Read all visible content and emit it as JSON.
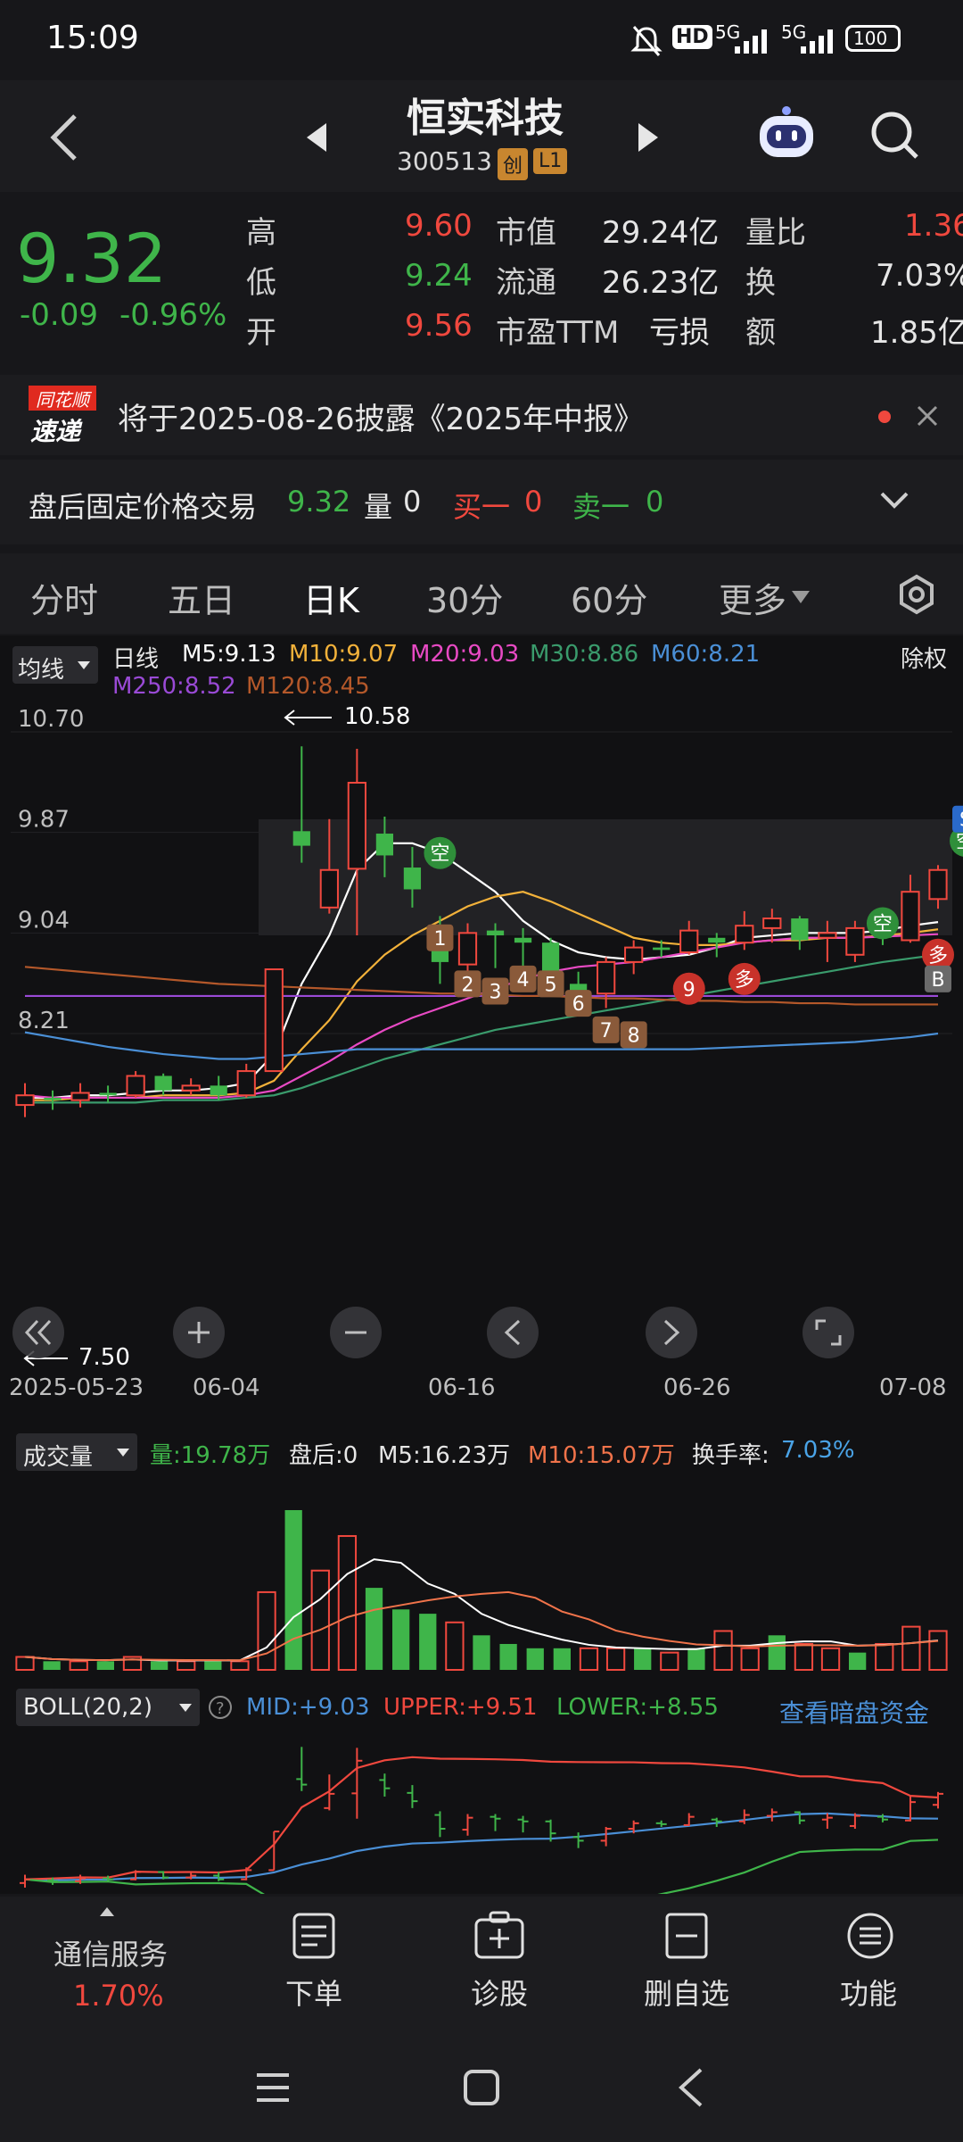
{
  "status": {
    "time": "15:09",
    "battery": "100",
    "net1": "5G",
    "net2": "5G"
  },
  "header": {
    "title": "恒实科技",
    "code": "300513",
    "badge1": "创",
    "badge2": "L1"
  },
  "quote": {
    "price": "9.32",
    "change": "-0.09",
    "pct": "-0.96%",
    "high_label": "高",
    "high": "9.60",
    "low_label": "低",
    "low": "9.24",
    "open_label": "开",
    "open": "9.56",
    "mcap_label": "市值",
    "mcap": "29.24亿",
    "float_label": "流通",
    "float": "26.23亿",
    "pe_label": "市盈TTM",
    "pe": "亏损",
    "vr_label": "量比",
    "vr": "1.36",
    "turn_label": "换",
    "turn": "7.03%",
    "amt_label": "额",
    "amt": "1.85亿"
  },
  "notice": {
    "logo_top": "同花顺",
    "logo_bottom": "速递",
    "text": "将于2025-08-26披露《2025年中报》"
  },
  "afterhours": {
    "label": "盘后固定价格交易",
    "price": "9.32",
    "vol_label": "量",
    "vol": "0",
    "buy_label": "买一",
    "buy": "0",
    "sell_label": "卖一",
    "sell": "0"
  },
  "tabs": [
    "分时",
    "五日",
    "日K",
    "30分",
    "60分",
    "更多"
  ],
  "ma_bar": {
    "selector": "均线",
    "period": "日线",
    "m5": "M5:9.13",
    "m10": "M10:9.07",
    "m20": "M20:9.03",
    "m30": "M30:8.86",
    "m60": "M60:8.21",
    "m250": "M250:8.52",
    "m120": "M120:8.45",
    "exright": "除权"
  },
  "chart_data": {
    "type": "candlestick",
    "y_ticks": [
      "10.70",
      "9.87",
      "9.04",
      "8.21"
    ],
    "x_ticks": [
      "2025-05-23",
      "06-04",
      "06-16",
      "06-26",
      "07-08"
    ],
    "max_label": "10.58",
    "min_label": "7.50",
    "candles": [
      {
        "o": 7.62,
        "c": 7.7,
        "h": 7.8,
        "l": 7.52
      },
      {
        "o": 7.68,
        "c": 7.66,
        "h": 7.74,
        "l": 7.58
      },
      {
        "o": 7.66,
        "c": 7.72,
        "h": 7.8,
        "l": 7.6
      },
      {
        "o": 7.72,
        "c": 7.7,
        "h": 7.78,
        "l": 7.64
      },
      {
        "o": 7.7,
        "c": 7.86,
        "h": 7.9,
        "l": 7.68
      },
      {
        "o": 7.86,
        "c": 7.74,
        "h": 7.88,
        "l": 7.7
      },
      {
        "o": 7.74,
        "c": 7.78,
        "h": 7.84,
        "l": 7.7
      },
      {
        "o": 7.78,
        "c": 7.7,
        "h": 7.86,
        "l": 7.66
      },
      {
        "o": 7.7,
        "c": 7.9,
        "h": 7.96,
        "l": 7.68
      },
      {
        "o": 7.9,
        "c": 8.74,
        "h": 8.74,
        "l": 7.9
      },
      {
        "o": 9.88,
        "c": 9.76,
        "h": 10.58,
        "l": 9.62
      },
      {
        "o": 9.25,
        "c": 9.56,
        "h": 9.98,
        "l": 9.2
      },
      {
        "o": 9.57,
        "c": 10.28,
        "h": 10.56,
        "l": 9.02
      },
      {
        "o": 9.86,
        "c": 9.68,
        "h": 10.0,
        "l": 9.5
      },
      {
        "o": 9.58,
        "c": 9.4,
        "h": 9.75,
        "l": 9.25
      },
      {
        "o": 9.1,
        "c": 8.8,
        "h": 9.18,
        "l": 8.62
      },
      {
        "o": 8.78,
        "c": 9.04,
        "h": 9.12,
        "l": 8.65
      },
      {
        "o": 9.06,
        "c": 9.02,
        "h": 9.12,
        "l": 8.75
      },
      {
        "o": 9.0,
        "c": 8.96,
        "h": 9.08,
        "l": 8.72
      },
      {
        "o": 8.96,
        "c": 8.7,
        "h": 9.0,
        "l": 8.52
      },
      {
        "o": 8.62,
        "c": 8.54,
        "h": 8.72,
        "l": 8.38
      },
      {
        "o": 8.54,
        "c": 8.8,
        "h": 8.84,
        "l": 8.42
      },
      {
        "o": 8.8,
        "c": 8.92,
        "h": 8.98,
        "l": 8.7
      },
      {
        "o": 8.92,
        "c": 8.9,
        "h": 8.98,
        "l": 8.84
      },
      {
        "o": 8.88,
        "c": 9.06,
        "h": 9.14,
        "l": 8.86
      },
      {
        "o": 9.0,
        "c": 8.96,
        "h": 9.04,
        "l": 8.84
      },
      {
        "o": 8.96,
        "c": 9.1,
        "h": 9.22,
        "l": 8.9
      },
      {
        "o": 9.08,
        "c": 9.16,
        "h": 9.24,
        "l": 8.96
      },
      {
        "o": 9.16,
        "c": 8.98,
        "h": 9.18,
        "l": 8.9
      },
      {
        "o": 9.0,
        "c": 9.04,
        "h": 9.14,
        "l": 8.8
      },
      {
        "o": 8.86,
        "c": 9.08,
        "h": 9.14,
        "l": 8.8
      },
      {
        "o": 9.06,
        "c": 9.0,
        "h": 9.12,
        "l": 8.94
      },
      {
        "o": 8.98,
        "c": 9.38,
        "h": 9.52,
        "l": 8.96
      },
      {
        "o": 9.32,
        "c": 9.56,
        "h": 9.6,
        "l": 9.24
      }
    ],
    "series": [
      {
        "name": "M5",
        "color": "#ffffff",
        "values": [
          7.68,
          7.68,
          7.7,
          7.7,
          7.72,
          7.74,
          7.74,
          7.76,
          7.8,
          8.04,
          8.62,
          9.02,
          9.56,
          9.78,
          9.78,
          9.7,
          9.54,
          9.38,
          9.14,
          8.98,
          8.88,
          8.84,
          8.82,
          8.84,
          8.86,
          8.92,
          9.0,
          9.02,
          9.04,
          9.04,
          9.04,
          9.06,
          9.1,
          9.13
        ]
      },
      {
        "name": "M10",
        "color": "#f2b13a",
        "values": [
          7.66,
          7.66,
          7.68,
          7.68,
          7.68,
          7.7,
          7.7,
          7.7,
          7.72,
          7.82,
          8.08,
          8.32,
          8.64,
          8.86,
          9.02,
          9.14,
          9.26,
          9.34,
          9.38,
          9.3,
          9.2,
          9.1,
          9.0,
          8.96,
          8.94,
          8.94,
          8.96,
          8.98,
          8.98,
          9.0,
          9.0,
          9.02,
          9.04,
          9.07
        ]
      },
      {
        "name": "M20",
        "color": "#e84ac4",
        "values": [
          7.7,
          7.68,
          7.68,
          7.68,
          7.68,
          7.68,
          7.68,
          7.68,
          7.7,
          7.74,
          7.86,
          7.98,
          8.12,
          8.24,
          8.34,
          8.42,
          8.5,
          8.58,
          8.66,
          8.72,
          8.76,
          8.78,
          8.8,
          8.84,
          8.88,
          8.92,
          8.96,
          8.98,
          9.0,
          9.0,
          9.0,
          9.01,
          9.02,
          9.03
        ]
      },
      {
        "name": "M30",
        "color": "#3a9b6c",
        "values": [
          7.64,
          7.64,
          7.64,
          7.64,
          7.64,
          7.66,
          7.66,
          7.66,
          7.68,
          7.7,
          7.76,
          7.84,
          7.92,
          8.0,
          8.06,
          8.12,
          8.18,
          8.24,
          8.28,
          8.32,
          8.36,
          8.4,
          8.44,
          8.48,
          8.52,
          8.56,
          8.6,
          8.64,
          8.68,
          8.72,
          8.76,
          8.8,
          8.83,
          8.86
        ]
      },
      {
        "name": "M60",
        "color": "#4a8fd6",
        "values": [
          8.22,
          8.18,
          8.14,
          8.1,
          8.07,
          8.04,
          8.02,
          8.0,
          8.0,
          8.02,
          8.04,
          8.06,
          8.08,
          8.08,
          8.08,
          8.08,
          8.08,
          8.08,
          8.08,
          8.08,
          8.08,
          8.08,
          8.08,
          8.08,
          8.08,
          8.09,
          8.1,
          8.11,
          8.12,
          8.13,
          8.14,
          8.16,
          8.18,
          8.21
        ]
      },
      {
        "name": "M250",
        "color": "#9a4ad6",
        "values": [
          8.52,
          8.52,
          8.52,
          8.52,
          8.52,
          8.52,
          8.52,
          8.52,
          8.52,
          8.52,
          8.52,
          8.52,
          8.52,
          8.52,
          8.52,
          8.52,
          8.52,
          8.52,
          8.52,
          8.52,
          8.52,
          8.52,
          8.52,
          8.52,
          8.52,
          8.52,
          8.52,
          8.52,
          8.52,
          8.52,
          8.52,
          8.52,
          8.52,
          8.52
        ]
      },
      {
        "name": "M120",
        "color": "#b4582a",
        "values": [
          8.76,
          8.74,
          8.72,
          8.7,
          8.68,
          8.66,
          8.64,
          8.62,
          8.61,
          8.6,
          8.59,
          8.58,
          8.57,
          8.56,
          8.55,
          8.54,
          8.54,
          8.53,
          8.52,
          8.52,
          8.51,
          8.5,
          8.5,
          8.49,
          8.48,
          8.48,
          8.47,
          8.47,
          8.46,
          8.46,
          8.45,
          8.45,
          8.45,
          8.45
        ]
      }
    ],
    "markers": [
      {
        "label": "空",
        "i": 15,
        "y": 9.7,
        "kind": "green"
      },
      {
        "label": "1",
        "i": 15,
        "y": 9.0,
        "kind": "num"
      },
      {
        "label": "2",
        "i": 16,
        "y": 8.62,
        "kind": "num"
      },
      {
        "label": "3",
        "i": 17,
        "y": 8.56,
        "kind": "num"
      },
      {
        "label": "4",
        "i": 18,
        "y": 8.66,
        "kind": "num"
      },
      {
        "label": "5",
        "i": 19,
        "y": 8.62,
        "kind": "num"
      },
      {
        "label": "6",
        "i": 20,
        "y": 8.46,
        "kind": "num"
      },
      {
        "label": "7",
        "i": 21,
        "y": 8.24,
        "kind": "num"
      },
      {
        "label": "8",
        "i": 22,
        "y": 8.2,
        "kind": "num"
      },
      {
        "label": "9",
        "i": 24,
        "y": 8.58,
        "kind": "red"
      },
      {
        "label": "多",
        "i": 26,
        "y": 8.66,
        "kind": "red"
      },
      {
        "label": "空",
        "i": 31,
        "y": 9.12,
        "kind": "green"
      },
      {
        "label": "多",
        "i": 33,
        "y": 8.86,
        "kind": "red"
      },
      {
        "label": "B",
        "i": 33,
        "y": 8.66,
        "kind": "grey"
      },
      {
        "label": "空",
        "i": 34,
        "y": 9.8,
        "kind": "green"
      },
      {
        "label": "S",
        "i": 34,
        "y": 9.98,
        "kind": "blue"
      }
    ]
  },
  "volume": {
    "selector": "成交量",
    "vol": "量:19.78万",
    "after": "盘后:0",
    "m5": "M5:16.23万",
    "m10": "M10:15.07万",
    "turnover_label": "换手率:",
    "turnover": "7.03%",
    "bars": [
      3,
      2,
      2,
      2,
      3,
      2,
      2,
      2,
      2,
      18,
      37,
      23,
      31,
      19,
      14,
      13,
      11,
      8,
      6,
      5,
      5,
      5,
      5,
      5,
      4,
      5,
      9,
      5,
      8,
      6,
      5,
      4,
      6,
      10,
      9
    ]
  },
  "boll": {
    "selector": "BOLL(20,2)",
    "mid": "MID:+9.03",
    "upper": "UPPER:+9.51",
    "lower": "LOWER:+8.55",
    "link": "查看暗盘资金"
  },
  "bottom": {
    "sector": "通信服务",
    "sector_pct": "1.70%",
    "order": "下单",
    "diagnose": "诊股",
    "remove": "删自选",
    "func": "功能"
  }
}
